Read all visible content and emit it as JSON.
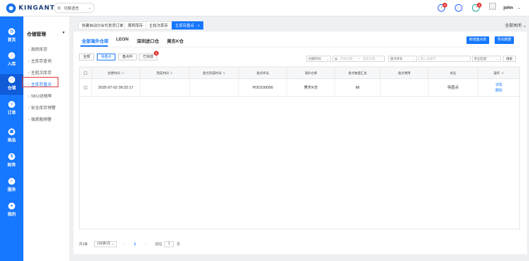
{
  "header": {
    "logo_text": "KINGANT",
    "language_label": "切换语言",
    "notification_badge": "4",
    "message_badge": "",
    "status_badge": "4",
    "username": "john"
  },
  "nav": [
    {
      "label": "首页",
      "icon": "dashboard-icon"
    },
    {
      "label": "入库",
      "icon": "inbound-icon"
    },
    {
      "label": "仓储",
      "icon": "warehouse-icon"
    },
    {
      "label": "订单",
      "icon": "order-icon"
    },
    {
      "label": "商品",
      "icon": "product-icon"
    },
    {
      "label": "财务",
      "icon": "finance-icon"
    },
    {
      "label": "服务",
      "icon": "service-icon"
    },
    {
      "label": "我的",
      "icon": "profile-icon"
    }
  ],
  "submenu": {
    "title": "仓储管理",
    "items": [
      "周转库存",
      "主库存查询",
      "主批次库存",
      "主库存盘点",
      "SKU动销率",
      "安全库存预警",
      "保质期预警"
    ]
  },
  "tabs": [
    "创建自动分合代发货订单",
    "周转库存",
    "主批次库存",
    "主库存盘点"
  ],
  "close_all": "全部关闭",
  "warehouse_tabs": [
    "全部海外仓库",
    "LEON",
    "深圳进口仓",
    "美东K仓"
  ],
  "buttons": {
    "create": "新增盘点单",
    "export": "导出数据"
  },
  "filters": {
    "status_buttons": [
      "全部",
      "待盘点",
      "盘点中",
      "已完成"
    ],
    "completed_badge": "1",
    "time_type": "创建时间",
    "start_placeholder": "开始日期",
    "date_sep": "~",
    "end_placeholder": "结束日期",
    "field_type": "盘点单号",
    "keyword_placeholder": "输入关键字",
    "match_type": "完全匹配",
    "search_label": "搜索"
  },
  "table": {
    "columns": [
      "创建时间",
      "完成时间",
      "盘点完成时间",
      "盘点单号",
      "海外仓库",
      "盘点数量汇总",
      "盘点费用",
      "状态",
      "操作"
    ],
    "rows": [
      {
        "created": "2025-07-02 09:32:17",
        "finished": "",
        "count_finished": "",
        "order_no": "PDD100056",
        "warehouse": "美东K仓",
        "qty_total": "86",
        "fee": "",
        "status": "待盘点",
        "actions": [
          "详情",
          "删除"
        ]
      }
    ]
  },
  "pagination": {
    "total": "共1条",
    "page_size": "100条/页",
    "prev": "‹",
    "current_page": "1",
    "next": "›",
    "goto_label": "前往",
    "goto_value": "1",
    "page_unit": "页"
  }
}
